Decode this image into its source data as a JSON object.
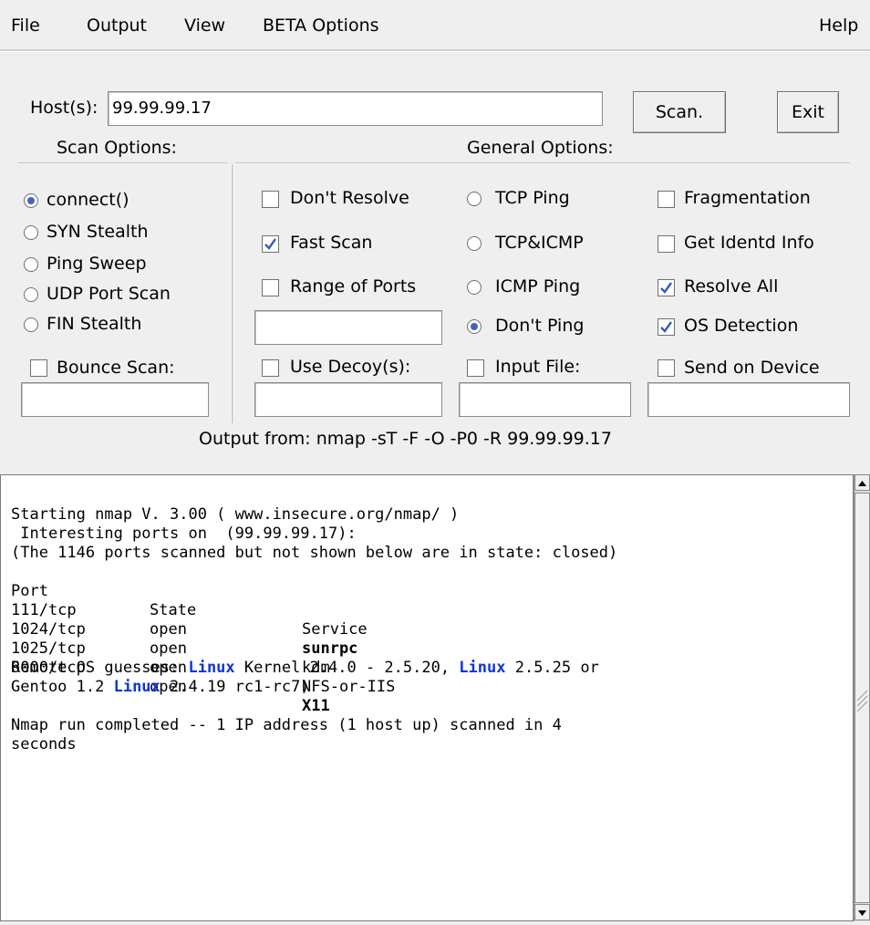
{
  "menu": {
    "file": "File",
    "output": "Output",
    "view": "View",
    "beta": "BETA Options",
    "help": "Help"
  },
  "host": {
    "label": "Host(s):",
    "value": "99.99.99.17"
  },
  "buttons": {
    "scan": "Scan.",
    "exit": "Exit"
  },
  "scan_options": {
    "title": "Scan Options:",
    "radios": [
      {
        "label": "connect()",
        "selected": true
      },
      {
        "label": "SYN Stealth",
        "selected": false
      },
      {
        "label": "Ping Sweep",
        "selected": false
      },
      {
        "label": "UDP Port Scan",
        "selected": false
      },
      {
        "label": "FIN Stealth",
        "selected": false
      }
    ],
    "bounce": {
      "label": "Bounce Scan:",
      "checked": false
    }
  },
  "general_options": {
    "title": "General Options:",
    "col1": [
      {
        "label": "Don't Resolve",
        "checked": false
      },
      {
        "label": "Fast Scan",
        "checked": true
      },
      {
        "label": "Range of Ports",
        "checked": false
      }
    ],
    "use_decoy": {
      "label": "Use Decoy(s):",
      "checked": false
    },
    "ping": [
      {
        "label": "TCP Ping",
        "selected": false
      },
      {
        "label": "TCP&ICMP",
        "selected": false
      },
      {
        "label": "ICMP Ping",
        "selected": false
      },
      {
        "label": "Don't Ping",
        "selected": true
      }
    ],
    "input_file": {
      "label": "Input File:",
      "checked": false
    },
    "col3": [
      {
        "label": "Fragmentation",
        "checked": false
      },
      {
        "label": "Get Identd Info",
        "checked": false
      },
      {
        "label": "Resolve All",
        "checked": true
      },
      {
        "label": "OS Detection",
        "checked": true
      }
    ],
    "send_device": {
      "label": "Send on Device",
      "checked": false
    }
  },
  "command_line": "Output from: nmap -sT  -F -O -P0 -R 99.99.99.17",
  "output": {
    "line1": "Starting nmap V. 3.00 ( www.insecure.org/nmap/ )",
    "line2": " Interesting ports on  (99.99.99.17):",
    "line3": "(The 1146 ports scanned but not shown below are in state: closed)",
    "header": {
      "port": "Port",
      "state": "State",
      "service": "Service"
    },
    "rows": [
      {
        "port": "111/tcp",
        "state": "open",
        "service": "sunrpc",
        "bold": true
      },
      {
        "port": "1024/tcp",
        "state": "open",
        "service": "kdm",
        "bold": false
      },
      {
        "port": "1025/tcp",
        "state": "open",
        "service": "NFS-or-IIS",
        "bold": false
      },
      {
        "port": "6000/tcp",
        "state": "open",
        "service": "X11",
        "bold": true
      }
    ],
    "os_a": "Remote OS guesses: ",
    "os_linux": "Linux",
    "os_b": " Kernel 2.4.0 - 2.5.20, ",
    "os_c": " 2.5.25 or",
    "os_d": "Gentoo 1.2 ",
    "os_e": " 2.4.19 rc1-rc7)",
    "done1": "Nmap run completed -- 1 IP address (1 host up) scanned in 4",
    "done2": "seconds"
  },
  "colors": {
    "highlight": "#1034d8",
    "radio_dot": "#4a62b5",
    "check_mark": "#3a5ab8"
  }
}
